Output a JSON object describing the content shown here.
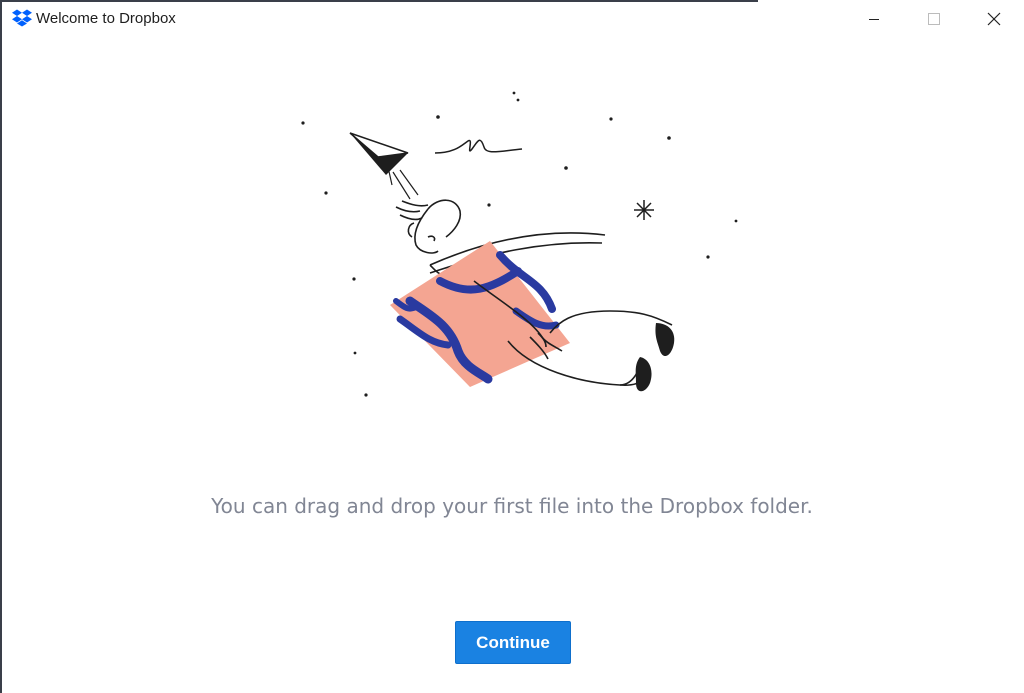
{
  "window": {
    "title": "Welcome to Dropbox",
    "controls": {
      "minimize_icon": "minimize-icon",
      "maximize_icon": "maximize-icon",
      "close_icon": "close-icon"
    }
  },
  "main": {
    "illustration_icon": "flying-person-with-box-illustration",
    "message": "You can drag and drop your first file into the Dropbox folder.",
    "continue_label": "Continue"
  },
  "colors": {
    "brand_blue": "#1a82e2",
    "message_text": "#818694",
    "box_pink": "#f4a592",
    "box_blue": "#2a3aa0"
  }
}
